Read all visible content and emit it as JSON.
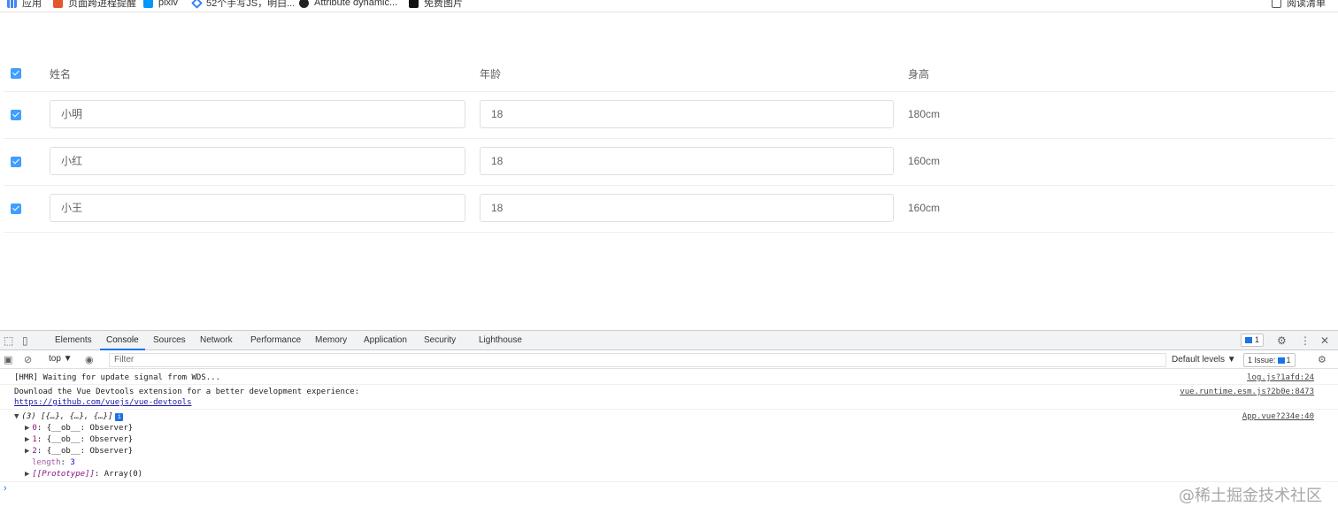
{
  "bookmarks": {
    "items": [
      {
        "label": "应用",
        "icon": "apps-grid-icon"
      },
      {
        "label": "页面跨进程提醒",
        "icon": "c-site-icon"
      },
      {
        "label": "pixiv",
        "icon": "pixiv-icon"
      },
      {
        "label": "52个手写JS，明白...",
        "icon": "diamond-icon"
      },
      {
        "label": "Attribute dynamic...",
        "icon": "github-icon"
      },
      {
        "label": "免费图片",
        "icon": "black-square-icon"
      }
    ],
    "reading_list": "阅读清单"
  },
  "table": {
    "headers": {
      "name": "姓名",
      "age": "年龄",
      "height": "身高"
    },
    "rows": [
      {
        "name": "小明",
        "age": "18",
        "height": "180cm",
        "checked": true
      },
      {
        "name": "小红",
        "age": "18",
        "height": "160cm",
        "checked": true
      },
      {
        "name": "小王",
        "age": "18",
        "height": "160cm",
        "checked": true
      }
    ],
    "all_checked": true
  },
  "devtools": {
    "tabs": [
      "Elements",
      "Console",
      "Sources",
      "Network",
      "Performance",
      "Memory",
      "Application",
      "Security",
      "Lighthouse"
    ],
    "active_tab": "Console",
    "messages_count": "1",
    "context": "top ▼",
    "filter_placeholder": "Filter",
    "levels": "Default levels ▼",
    "issues": {
      "label": "1 Issue:",
      "count": "1"
    },
    "console": {
      "line1": {
        "text": "[HMR] Waiting for update signal from WDS...",
        "source": "log.js?1afd:24"
      },
      "line2": {
        "text": "Download the Vue Devtools extension for a better development experience:",
        "link": "https://github.com/vuejs/vue-devtools",
        "source": "vue.runtime.esm.js?2b0e:8473"
      },
      "line3": {
        "summary": "(3) [{…}, {…}, {…}]",
        "source": "App.vue?234e:40",
        "items": [
          {
            "key": "0",
            "value": "{__ob__: Observer}"
          },
          {
            "key": "1",
            "value": "{__ob__: Observer}"
          },
          {
            "key": "2",
            "value": "{__ob__: Observer}"
          }
        ],
        "length_key": "length",
        "length_value": "3",
        "proto_key": "[[Prototype]]",
        "proto_value": "Array(0)"
      }
    }
  },
  "watermark": "@稀土掘金技术社区",
  "colors": {
    "accent": "#409eff",
    "devtools_blue": "#1a73e8"
  }
}
